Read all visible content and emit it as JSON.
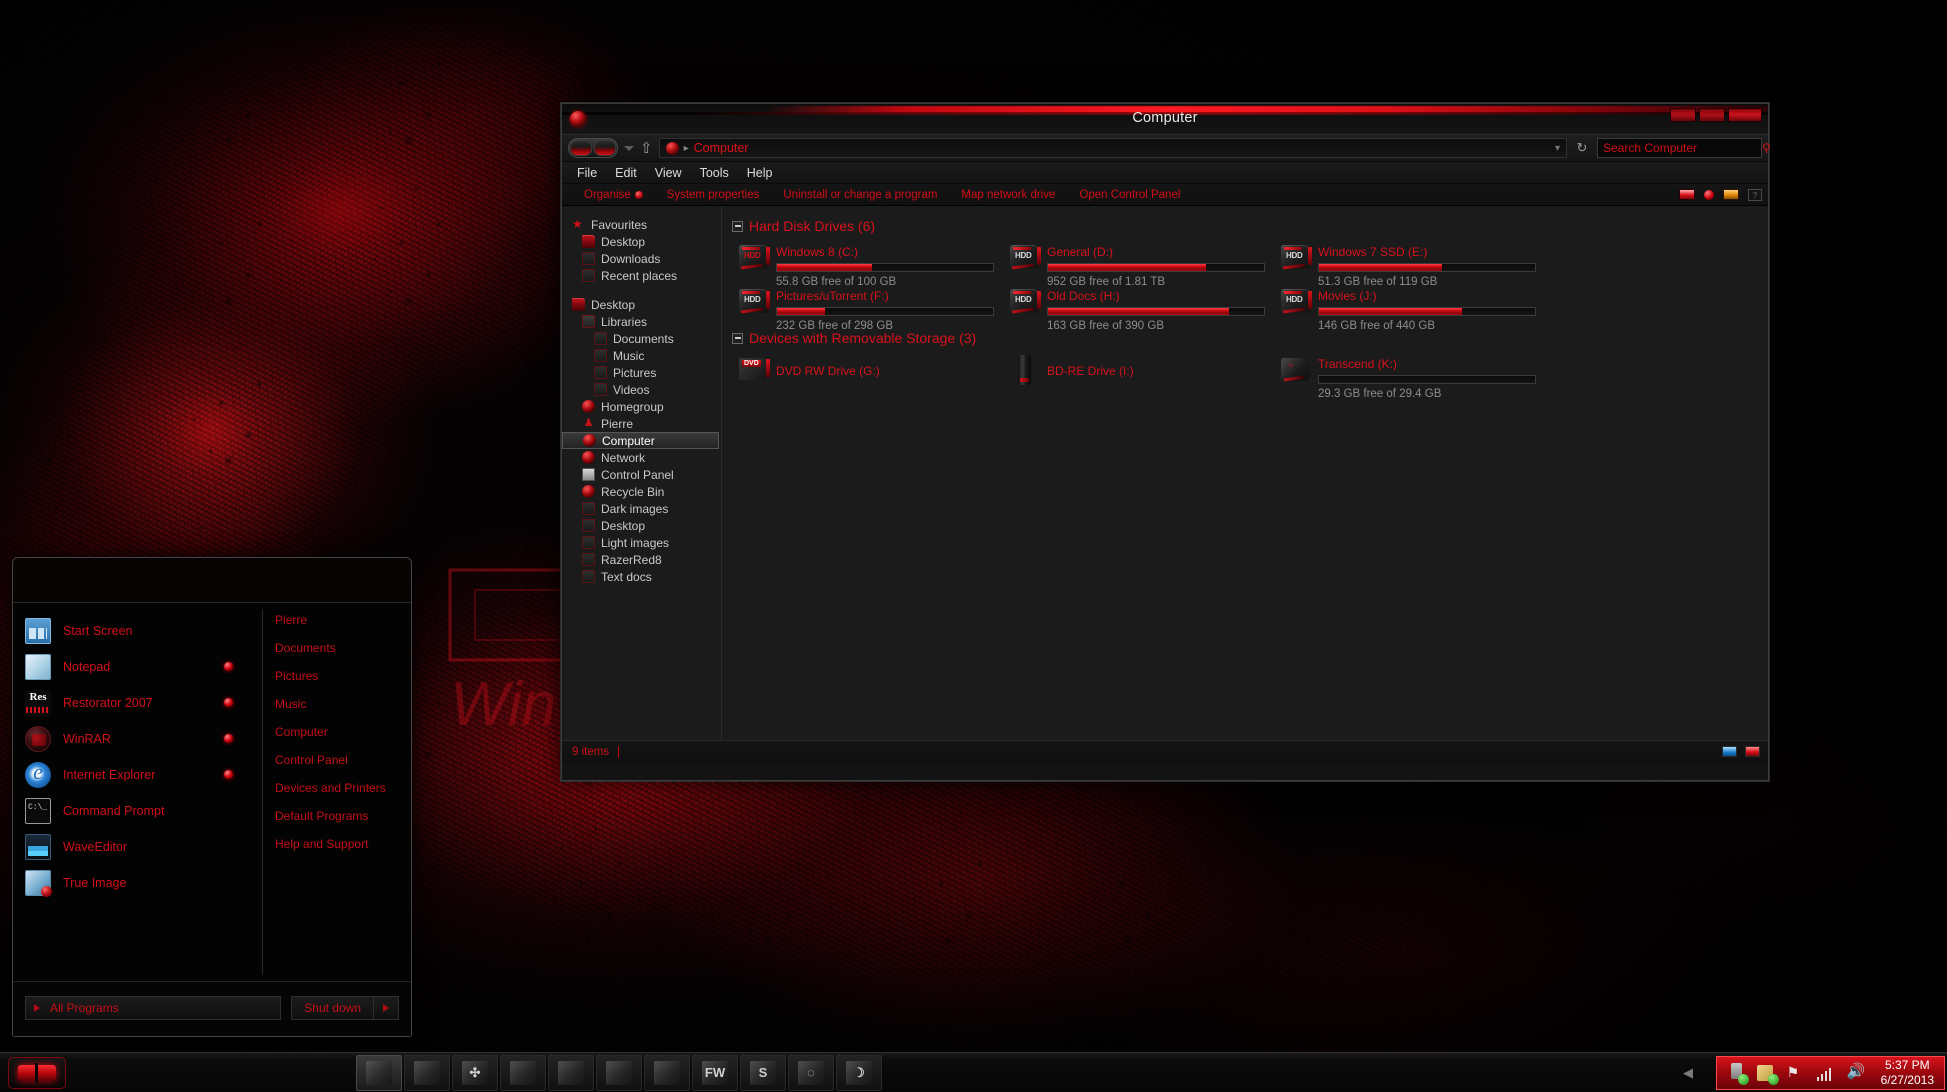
{
  "window": {
    "title": "Computer",
    "buttons": {
      "minimize": "minimize",
      "maximize": "maximize",
      "close": "close"
    }
  },
  "address_bar": {
    "path_text": "Computer",
    "separator": "▸",
    "dropdown": "▾",
    "refresh": "↻",
    "up_arrow": "⇧"
  },
  "search": {
    "placeholder": "Search Computer",
    "icon": "⚲"
  },
  "menu_bar": {
    "items": [
      "File",
      "Edit",
      "View",
      "Tools",
      "Help"
    ]
  },
  "command_bar": {
    "items": [
      "Organise",
      "System properties",
      "Uninstall or change a program",
      "Map network drive",
      "Open Control Panel"
    ]
  },
  "nav_pane": {
    "items": [
      {
        "label": "Favourites",
        "icon": "star-icon",
        "level": 0,
        "type": "star"
      },
      {
        "label": "Desktop",
        "icon": "folder-icon",
        "level": 1,
        "type": "folder"
      },
      {
        "label": "Downloads",
        "icon": "downloads-folder-icon",
        "level": 1,
        "type": "folderdark"
      },
      {
        "label": "Recent places",
        "icon": "recent-places-icon",
        "level": 1,
        "type": "folderdark"
      },
      {
        "label": "",
        "icon": "",
        "level": 0,
        "type": "gap"
      },
      {
        "label": "Desktop",
        "icon": "folder-icon",
        "level": 0,
        "type": "folder"
      },
      {
        "label": "Libraries",
        "icon": "libraries-icon",
        "level": 1,
        "type": "lib"
      },
      {
        "label": "Documents",
        "icon": "documents-icon",
        "level": 2,
        "type": "folderdark"
      },
      {
        "label": "Music",
        "icon": "music-icon",
        "level": 2,
        "type": "folderdark"
      },
      {
        "label": "Pictures",
        "icon": "pictures-icon",
        "level": 2,
        "type": "folderdark"
      },
      {
        "label": "Videos",
        "icon": "videos-icon",
        "level": 2,
        "type": "folderdark"
      },
      {
        "label": "Homegroup",
        "icon": "homegroup-icon",
        "level": 1,
        "type": "orb"
      },
      {
        "label": "Pierre",
        "icon": "user-icon",
        "level": 1,
        "type": "person"
      },
      {
        "label": "Computer",
        "icon": "computer-icon",
        "level": 1,
        "type": "orb",
        "selected": true
      },
      {
        "label": "Network",
        "icon": "network-icon",
        "level": 1,
        "type": "orb"
      },
      {
        "label": "Control Panel",
        "icon": "control-panel-icon",
        "level": 1,
        "type": "cp"
      },
      {
        "label": "Recycle Bin",
        "icon": "recycle-bin-icon",
        "level": 1,
        "type": "orb"
      },
      {
        "label": "Dark images",
        "icon": "folder-icon",
        "level": 1,
        "type": "folderdark"
      },
      {
        "label": "Desktop",
        "icon": "folder-icon",
        "level": 1,
        "type": "folderdark"
      },
      {
        "label": "Light images",
        "icon": "folder-icon",
        "level": 1,
        "type": "folderdark"
      },
      {
        "label": "RazerRed8",
        "icon": "folder-icon",
        "level": 1,
        "type": "folderdark"
      },
      {
        "label": "Text docs",
        "icon": "folder-icon",
        "level": 1,
        "type": "folderdark"
      }
    ]
  },
  "groups": [
    {
      "title": "Hard Disk Drives (6)",
      "drives": [
        {
          "name": "Windows 8 (C:)",
          "free": "55.8 GB free of 100 GB",
          "fill_pct": 44,
          "icon": "hdd-icon",
          "label": "HDD",
          "label_red": true
        },
        {
          "name": "General (D:)",
          "free": "952 GB free of 1.81 TB",
          "fill_pct": 73,
          "icon": "hdd-icon",
          "label": "HDD",
          "label_red": false
        },
        {
          "name": "Windows 7 SSD (E:)",
          "free": "51.3 GB free of 119 GB",
          "fill_pct": 57,
          "icon": "hdd-icon",
          "label": "HDD",
          "label_red": false
        },
        {
          "name": "Pictures/uTorrent (F:)",
          "free": "232 GB free of 298 GB",
          "fill_pct": 22,
          "icon": "hdd-icon",
          "label": "HDD",
          "label_red": false
        },
        {
          "name": "Old Docs (H:)",
          "free": "163 GB free of 390 GB",
          "fill_pct": 84,
          "icon": "hdd-icon",
          "label": "HDD",
          "label_red": false
        },
        {
          "name": "Movies (J:)",
          "free": "146 GB free of 440 GB",
          "fill_pct": 66,
          "icon": "hdd-icon",
          "label": "HDD",
          "label_red": false
        }
      ]
    },
    {
      "title": "Devices with Removable Storage (3)",
      "drives": [
        {
          "name": "DVD RW Drive (G:)",
          "free": "",
          "fill_pct": null,
          "icon": "dvd-drive-icon",
          "label": "DVD"
        },
        {
          "name": "BD-RE Drive (I:)",
          "free": "",
          "fill_pct": null,
          "icon": "bd-re-drive-icon",
          "label": ""
        },
        {
          "name": "Transcend (K:)",
          "free": "29.3 GB free of 29.4 GB",
          "fill_pct": 1,
          "icon": "usb-drive-icon",
          "label": ""
        }
      ]
    }
  ],
  "status_bar": {
    "items_text": "9 items",
    "separator": "|"
  },
  "start_menu": {
    "apps": [
      {
        "label": "Start Screen",
        "icon": "start-screen-icon",
        "pinned": false
      },
      {
        "label": "Notepad",
        "icon": "notepad-icon",
        "pinned": true
      },
      {
        "label": "Restorator 2007",
        "icon": "restorator-icon",
        "pinned": true
      },
      {
        "label": "WinRAR",
        "icon": "winrar-icon",
        "pinned": true
      },
      {
        "label": "Internet Explorer",
        "icon": "internet-explorer-icon",
        "pinned": true
      },
      {
        "label": "Command Prompt",
        "icon": "command-prompt-icon",
        "pinned": false
      },
      {
        "label": "WaveEditor",
        "icon": "waveeditor-icon",
        "pinned": false
      },
      {
        "label": "True Image",
        "icon": "true-image-icon",
        "pinned": false
      }
    ],
    "links": [
      "Pierre",
      "Documents",
      "Pictures",
      "Music",
      "Computer",
      "Control Panel",
      "Devices and Printers",
      "Default Programs",
      "Help and Support"
    ],
    "all_programs": "All Programs",
    "shutdown": "Shut down",
    "shutdown_arrow": "▸"
  },
  "taskbar": {
    "start_button": "start-orb",
    "apps": [
      {
        "name": "taskbar-app-1",
        "glyph": ""
      },
      {
        "name": "taskbar-app-2",
        "glyph": ""
      },
      {
        "name": "taskbar-app-3",
        "glyph": "✣"
      },
      {
        "name": "taskbar-app-4",
        "glyph": ""
      },
      {
        "name": "taskbar-app-5",
        "glyph": ""
      },
      {
        "name": "taskbar-app-6",
        "glyph": ""
      },
      {
        "name": "taskbar-app-7",
        "glyph": ""
      },
      {
        "name": "taskbar-app-8",
        "glyph": "FW"
      },
      {
        "name": "taskbar-app-9",
        "glyph": "S"
      },
      {
        "name": "taskbar-app-10",
        "glyph": "◌"
      },
      {
        "name": "taskbar-app-11",
        "glyph": "☽"
      }
    ],
    "tray": {
      "show_hidden": "◀",
      "time": "5:37 PM",
      "date": "6/27/2013",
      "flag_glyph": "⚑",
      "volume_glyph": "🔊"
    }
  },
  "colors": {
    "accent_red": "#d8121c",
    "text_red": "#cf1018",
    "muted_grey": "#8d8d8d",
    "nav_text": "#c9c9c9"
  }
}
